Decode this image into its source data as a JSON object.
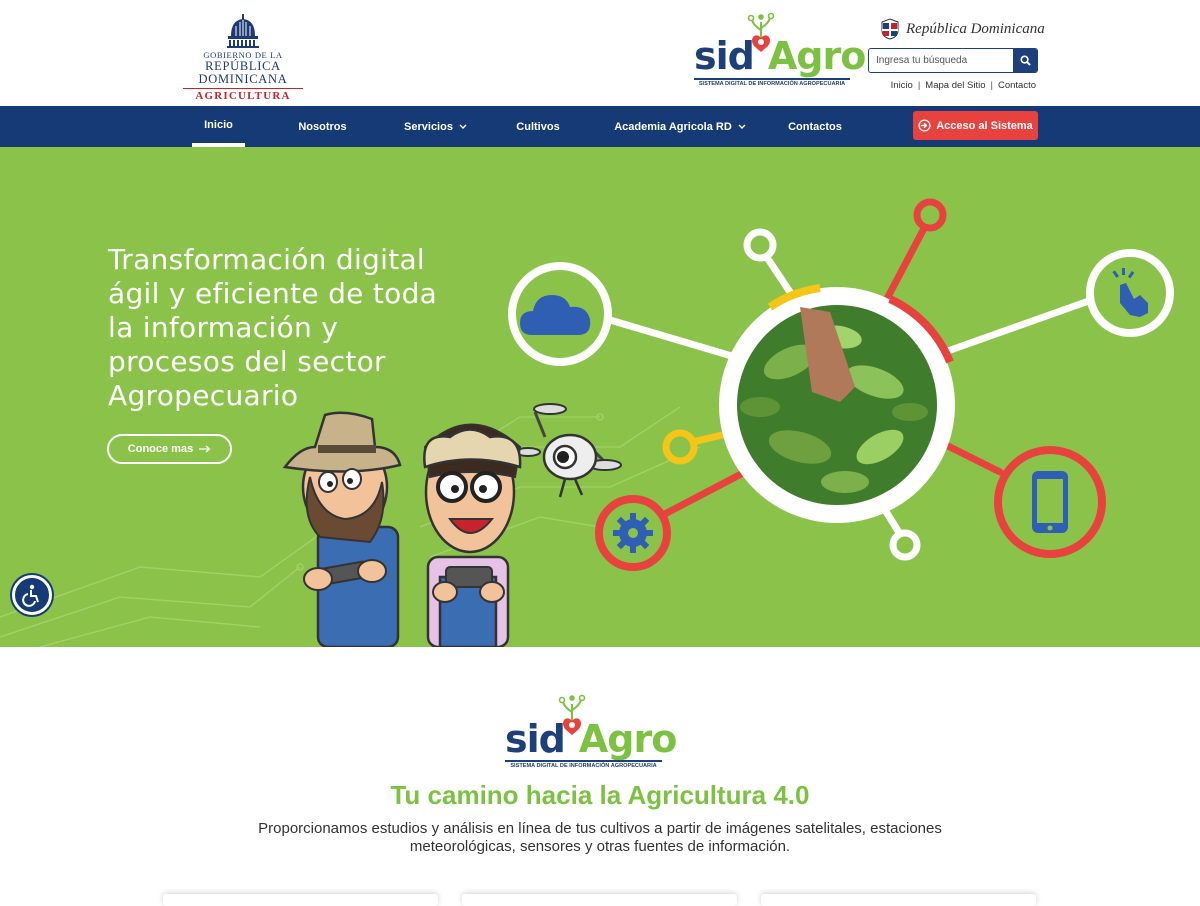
{
  "header": {
    "gov_logo": {
      "line1": "GOBIERNO DE LA",
      "line2": "REPÚBLICA DOMINICANA",
      "line3": "AGRICULTURA"
    },
    "sida_logo": {
      "sid": "sid",
      "agro": "Agro",
      "tagline": "SISTEMA DIGITAL DE INFORMACIÓN AGROPECUARIA"
    },
    "rd_brand": "República Dominicana",
    "search": {
      "placeholder": "Ingresa tu búsqueda",
      "icon": "search-icon"
    },
    "top_links": [
      "Inicio",
      "Mapa del Sitio",
      "Contacto"
    ]
  },
  "nav": {
    "items": [
      "Inicio",
      "Nosotros",
      "Servicios",
      "Cultivos",
      "Academia Agricola RD",
      "Contactos"
    ],
    "active": "Inicio",
    "dropdown_items": [
      "Servicios",
      "Academia Agricola RD"
    ],
    "access_button": "Acceso al Sistema"
  },
  "hero": {
    "title": "Transformación digital ágil y eficiente de toda la información y procesos del sector Agropecuario",
    "button": "Conoce mas",
    "icons": [
      "cloud-icon",
      "tap-hand-icon",
      "gear-icon",
      "smartphone-icon"
    ]
  },
  "intro": {
    "title": "Tu camino hacia la Agricultura 4.0",
    "text": "Proporcionamos estudios y análisis en línea de tus cultivos a partir de imágenes satelitales, estaciones meteorológicas, sensores y otras fuentes de información."
  },
  "colors": {
    "navy": "#163a75",
    "green": "#8bc34a",
    "brand_green": "#7cc142",
    "red": "#e8423f",
    "yellow": "#f5c518"
  }
}
